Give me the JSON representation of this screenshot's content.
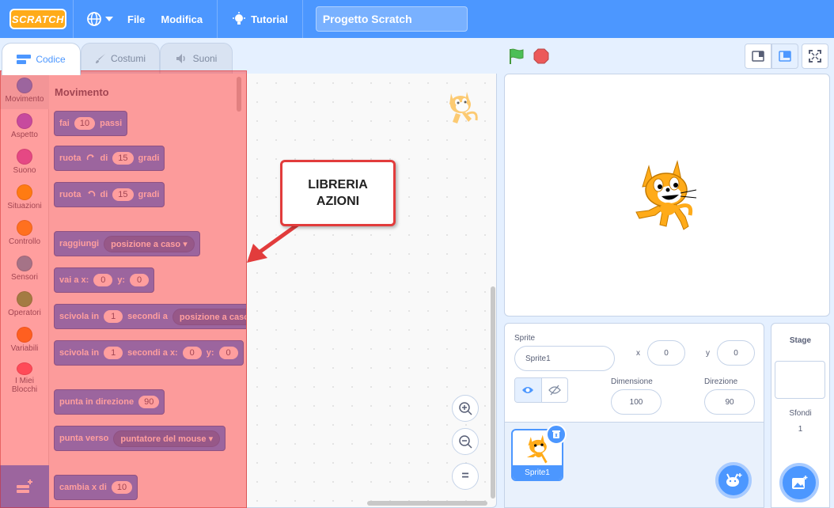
{
  "menubar": {
    "logo": "SCRATCH",
    "file": "File",
    "edit": "Modifica",
    "tutorials": "Tutorial",
    "project_title": "Progetto Scratch"
  },
  "tabs": [
    {
      "label": "Codice",
      "icon": "code-icon"
    },
    {
      "label": "Costumi",
      "icon": "brush-icon"
    },
    {
      "label": "Suoni",
      "icon": "speaker-icon"
    }
  ],
  "categories": [
    {
      "label": "Movimento",
      "color": "#4c97ff"
    },
    {
      "label": "Aspetto",
      "color": "#9966ff"
    },
    {
      "label": "Suono",
      "color": "#cf63cf"
    },
    {
      "label": "Situazioni",
      "color": "#ffbf00"
    },
    {
      "label": "Controllo",
      "color": "#ffab19"
    },
    {
      "label": "Sensori",
      "color": "#5cb1d6"
    },
    {
      "label": "Operatori",
      "color": "#59c059"
    },
    {
      "label": "Variabili",
      "color": "#ff8c1a"
    },
    {
      "label": "I Miei Blocchi",
      "color": "#ff6680"
    }
  ],
  "palette": {
    "title": "Movimento",
    "blocks": {
      "move": {
        "a": "fai",
        "v": "10",
        "b": "passi"
      },
      "turn_right": {
        "a": "ruota",
        "b": "di",
        "v": "15",
        "c": "gradi"
      },
      "turn_left": {
        "a": "ruota",
        "b": "di",
        "v": "15",
        "c": "gradi"
      },
      "goto": {
        "a": "raggiungi",
        "drop": "posizione a caso"
      },
      "goto_xy": {
        "a": "vai a x:",
        "x": "0",
        "b": "y:",
        "y": "0"
      },
      "glide": {
        "a": "scivola in",
        "v": "1",
        "b": "secondi a",
        "drop": "posizione a caso"
      },
      "glide_xy": {
        "a": "scivola in",
        "v": "1",
        "b": "secondi a x:",
        "x": "0",
        "c": "y:",
        "y": "0"
      },
      "point_dir": {
        "a": "punta in direzione",
        "v": "90"
      },
      "point_towards": {
        "a": "punta verso",
        "drop": "puntatore del mouse"
      },
      "change_x": {
        "a": "cambia x di",
        "v": "10"
      }
    }
  },
  "callout": {
    "line1": "LIBRERIA",
    "line2": "AZIONI"
  },
  "zoom": {
    "in": "+",
    "out": "−",
    "reset": "="
  },
  "sprite_info": {
    "sprite_label": "Sprite",
    "sprite_name": "Sprite1",
    "x_label": "x",
    "x_value": "0",
    "y_label": "y",
    "y_value": "0",
    "size_label": "Dimensione",
    "size_value": "100",
    "direction_label": "Direzione",
    "direction_value": "90"
  },
  "sprites": [
    {
      "name": "Sprite1"
    }
  ],
  "stage_panel": {
    "title": "Stage",
    "backdrops_label": "Sfondi",
    "backdrops_count": "1"
  },
  "colors": {
    "accent": "#4c97ff",
    "overlay": "#ff2828",
    "callout_border": "#e23c3c"
  }
}
